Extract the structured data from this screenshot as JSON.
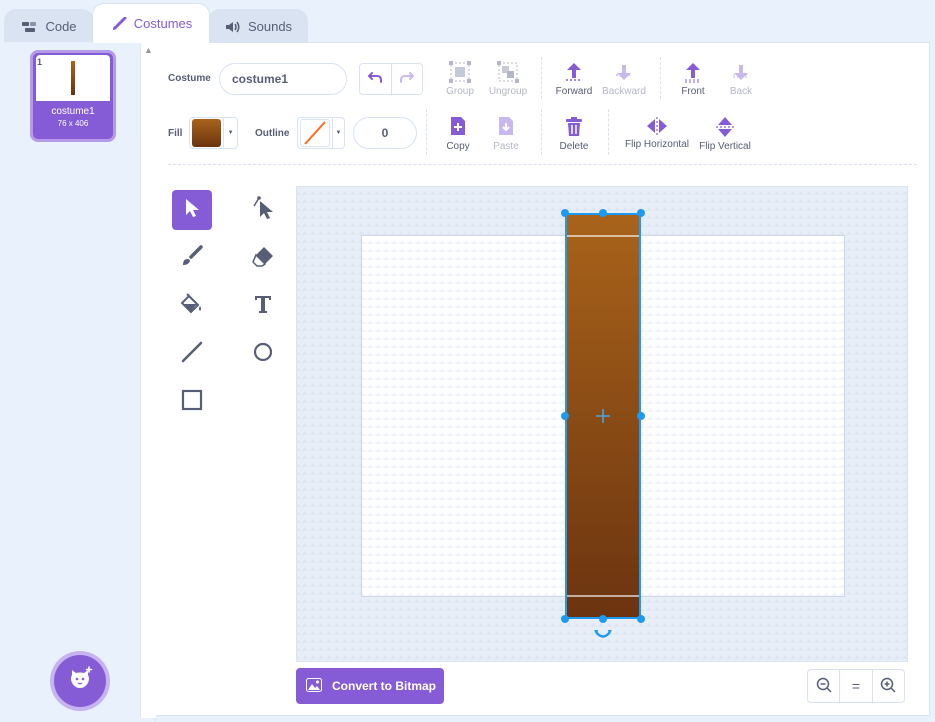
{
  "tabs": [
    {
      "label": "Code",
      "icon": "code-icon"
    },
    {
      "label": "Costumes",
      "icon": "paintbrush-icon"
    },
    {
      "label": "Sounds",
      "icon": "speaker-icon"
    }
  ],
  "costume_list": {
    "items": [
      {
        "number": "1",
        "name": "costume1",
        "size": "76 x 406"
      }
    ],
    "add_button_icon": "cat-add-icon"
  },
  "editor": {
    "costume_label": "Costume",
    "costume_name": "costume1",
    "fill_label": "Fill",
    "outline_label": "Outline",
    "outline_width": "0",
    "fill_color": "#8a4a17",
    "outline_color": "none",
    "toolbar_row1": {
      "group": "Group",
      "ungroup": "Ungroup",
      "forward": "Forward",
      "backward": "Backward",
      "front": "Front",
      "back": "Back"
    },
    "toolbar_row2": {
      "copy": "Copy",
      "paste": "Paste",
      "delete": "Delete",
      "flip_horizontal": "Flip Horizontal",
      "flip_vertical": "Flip Vertical"
    },
    "tools": [
      "select",
      "reshape",
      "brush",
      "eraser",
      "fill",
      "text",
      "line",
      "circle",
      "rectangle"
    ],
    "active_tool": "select",
    "convert_button": "Convert to Bitmap",
    "zoom_equal": "="
  },
  "colors": {
    "accent": "#855cd6",
    "selection": "#1e9bf0",
    "bar_top": "#a9631a",
    "bar_bottom": "#6b3410"
  }
}
